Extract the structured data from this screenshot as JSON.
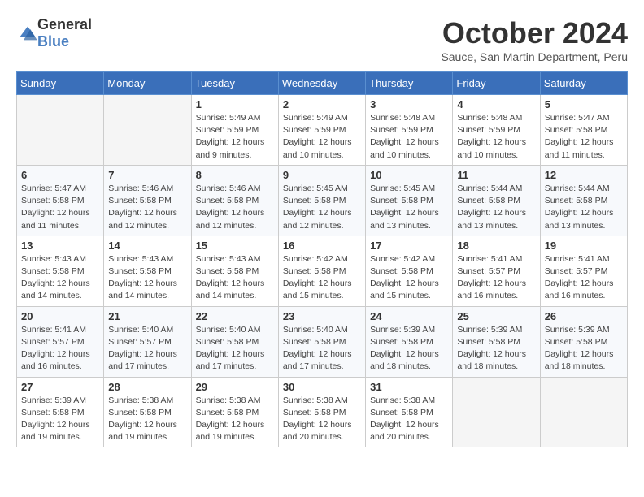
{
  "logo": {
    "general": "General",
    "blue": "Blue"
  },
  "header": {
    "month": "October 2024",
    "location": "Sauce, San Martin Department, Peru"
  },
  "weekdays": [
    "Sunday",
    "Monday",
    "Tuesday",
    "Wednesday",
    "Thursday",
    "Friday",
    "Saturday"
  ],
  "weeks": [
    [
      {
        "day": "",
        "info": ""
      },
      {
        "day": "",
        "info": ""
      },
      {
        "day": "1",
        "info": "Sunrise: 5:49 AM\nSunset: 5:59 PM\nDaylight: 12 hours and 9 minutes."
      },
      {
        "day": "2",
        "info": "Sunrise: 5:49 AM\nSunset: 5:59 PM\nDaylight: 12 hours and 10 minutes."
      },
      {
        "day": "3",
        "info": "Sunrise: 5:48 AM\nSunset: 5:59 PM\nDaylight: 12 hours and 10 minutes."
      },
      {
        "day": "4",
        "info": "Sunrise: 5:48 AM\nSunset: 5:59 PM\nDaylight: 12 hours and 10 minutes."
      },
      {
        "day": "5",
        "info": "Sunrise: 5:47 AM\nSunset: 5:58 PM\nDaylight: 12 hours and 11 minutes."
      }
    ],
    [
      {
        "day": "6",
        "info": "Sunrise: 5:47 AM\nSunset: 5:58 PM\nDaylight: 12 hours and 11 minutes."
      },
      {
        "day": "7",
        "info": "Sunrise: 5:46 AM\nSunset: 5:58 PM\nDaylight: 12 hours and 12 minutes."
      },
      {
        "day": "8",
        "info": "Sunrise: 5:46 AM\nSunset: 5:58 PM\nDaylight: 12 hours and 12 minutes."
      },
      {
        "day": "9",
        "info": "Sunrise: 5:45 AM\nSunset: 5:58 PM\nDaylight: 12 hours and 12 minutes."
      },
      {
        "day": "10",
        "info": "Sunrise: 5:45 AM\nSunset: 5:58 PM\nDaylight: 12 hours and 13 minutes."
      },
      {
        "day": "11",
        "info": "Sunrise: 5:44 AM\nSunset: 5:58 PM\nDaylight: 12 hours and 13 minutes."
      },
      {
        "day": "12",
        "info": "Sunrise: 5:44 AM\nSunset: 5:58 PM\nDaylight: 12 hours and 13 minutes."
      }
    ],
    [
      {
        "day": "13",
        "info": "Sunrise: 5:43 AM\nSunset: 5:58 PM\nDaylight: 12 hours and 14 minutes."
      },
      {
        "day": "14",
        "info": "Sunrise: 5:43 AM\nSunset: 5:58 PM\nDaylight: 12 hours and 14 minutes."
      },
      {
        "day": "15",
        "info": "Sunrise: 5:43 AM\nSunset: 5:58 PM\nDaylight: 12 hours and 14 minutes."
      },
      {
        "day": "16",
        "info": "Sunrise: 5:42 AM\nSunset: 5:58 PM\nDaylight: 12 hours and 15 minutes."
      },
      {
        "day": "17",
        "info": "Sunrise: 5:42 AM\nSunset: 5:58 PM\nDaylight: 12 hours and 15 minutes."
      },
      {
        "day": "18",
        "info": "Sunrise: 5:41 AM\nSunset: 5:57 PM\nDaylight: 12 hours and 16 minutes."
      },
      {
        "day": "19",
        "info": "Sunrise: 5:41 AM\nSunset: 5:57 PM\nDaylight: 12 hours and 16 minutes."
      }
    ],
    [
      {
        "day": "20",
        "info": "Sunrise: 5:41 AM\nSunset: 5:57 PM\nDaylight: 12 hours and 16 minutes."
      },
      {
        "day": "21",
        "info": "Sunrise: 5:40 AM\nSunset: 5:57 PM\nDaylight: 12 hours and 17 minutes."
      },
      {
        "day": "22",
        "info": "Sunrise: 5:40 AM\nSunset: 5:58 PM\nDaylight: 12 hours and 17 minutes."
      },
      {
        "day": "23",
        "info": "Sunrise: 5:40 AM\nSunset: 5:58 PM\nDaylight: 12 hours and 17 minutes."
      },
      {
        "day": "24",
        "info": "Sunrise: 5:39 AM\nSunset: 5:58 PM\nDaylight: 12 hours and 18 minutes."
      },
      {
        "day": "25",
        "info": "Sunrise: 5:39 AM\nSunset: 5:58 PM\nDaylight: 12 hours and 18 minutes."
      },
      {
        "day": "26",
        "info": "Sunrise: 5:39 AM\nSunset: 5:58 PM\nDaylight: 12 hours and 18 minutes."
      }
    ],
    [
      {
        "day": "27",
        "info": "Sunrise: 5:39 AM\nSunset: 5:58 PM\nDaylight: 12 hours and 19 minutes."
      },
      {
        "day": "28",
        "info": "Sunrise: 5:38 AM\nSunset: 5:58 PM\nDaylight: 12 hours and 19 minutes."
      },
      {
        "day": "29",
        "info": "Sunrise: 5:38 AM\nSunset: 5:58 PM\nDaylight: 12 hours and 19 minutes."
      },
      {
        "day": "30",
        "info": "Sunrise: 5:38 AM\nSunset: 5:58 PM\nDaylight: 12 hours and 20 minutes."
      },
      {
        "day": "31",
        "info": "Sunrise: 5:38 AM\nSunset: 5:58 PM\nDaylight: 12 hours and 20 minutes."
      },
      {
        "day": "",
        "info": ""
      },
      {
        "day": "",
        "info": ""
      }
    ]
  ]
}
